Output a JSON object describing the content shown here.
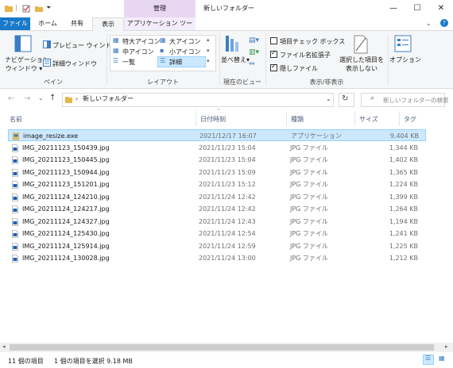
{
  "window": {
    "title": "新しいフォルダー",
    "context_tab_header": "管理",
    "minimize": "—",
    "maximize": "☐",
    "close": "✕"
  },
  "tabs": {
    "file": "ファイル",
    "home": "ホーム",
    "share": "共有",
    "view": "表示",
    "app_tools": "アプリケーション ツール"
  },
  "ribbon": {
    "pane": {
      "nav_pane": "ナビゲーション\nウィンドウ",
      "nav_pane_line1": "ナビゲーション",
      "nav_pane_line2": "ウィンドウ",
      "preview": "プレビュー ウィンドウ",
      "details": "詳細ウィンドウ",
      "label": "ペイン"
    },
    "layout": {
      "xl_icons": "特大アイコン",
      "l_icons": "大アイコン",
      "m_icons": "中アイコン",
      "s_icons": "小アイコン",
      "list": "一覧",
      "details": "詳細",
      "label": "レイアウト"
    },
    "current_view": {
      "sort": "並べ替え",
      "label": "現在のビュー"
    },
    "show_hide": {
      "item_checkboxes": "項目チェック ボックス",
      "file_extensions": "ファイル名拡張子",
      "hidden_items": "隠しファイル",
      "item_checkboxes_on": false,
      "file_extensions_on": true,
      "hidden_items_on": true,
      "hide_selected_line1": "選択した項目を",
      "hide_selected_line2": "表示しない",
      "options": "オプション",
      "label": "表示/非表示"
    }
  },
  "address": {
    "path": "新しいフォルダー",
    "search_placeholder": "新しいフォルダーの検索"
  },
  "columns": {
    "name": "名前",
    "date": "日付時刻",
    "type": "種類",
    "size": "サイズ",
    "tag": "タグ"
  },
  "files": [
    {
      "name": "image_resize.exe",
      "date": "2021/12/17 16:07",
      "type": "アプリケーション",
      "size": "9,404 KB",
      "icon": "exe-icon"
    },
    {
      "name": "IMG_20211123_150439.jpg",
      "date": "2021/11/23 15:04",
      "type": "JPG ファイル",
      "size": "1,344 KB",
      "icon": "jpg-file-icon"
    },
    {
      "name": "IMG_20211123_150445.jpg",
      "date": "2021/11/23 15:04",
      "type": "JPG ファイル",
      "size": "1,402 KB",
      "icon": "jpg-file-icon"
    },
    {
      "name": "IMG_20211123_150944.jpg",
      "date": "2021/11/23 15:09",
      "type": "JPG ファイル",
      "size": "1,365 KB",
      "icon": "jpg-file-icon"
    },
    {
      "name": "IMG_20211123_151201.jpg",
      "date": "2021/11/23 15:12",
      "type": "JPG ファイル",
      "size": "1,224 KB",
      "icon": "jpg-file-icon"
    },
    {
      "name": "IMG_20211124_124210.jpg",
      "date": "2021/11/24 12:42",
      "type": "JPG ファイル",
      "size": "1,399 KB",
      "icon": "jpg-file-icon"
    },
    {
      "name": "IMG_20211124_124217.jpg",
      "date": "2021/11/24 12:42",
      "type": "JPG ファイル",
      "size": "1,264 KB",
      "icon": "jpg-file-icon"
    },
    {
      "name": "IMG_20211124_124327.jpg",
      "date": "2021/11/24 12:43",
      "type": "JPG ファイル",
      "size": "1,194 KB",
      "icon": "jpg-file-icon"
    },
    {
      "name": "IMG_20211124_125430.jpg",
      "date": "2021/11/24 12:54",
      "type": "JPG ファイル",
      "size": "1,241 KB",
      "icon": "jpg-file-icon"
    },
    {
      "name": "IMG_20211124_125914.jpg",
      "date": "2021/11/24 12:59",
      "type": "JPG ファイル",
      "size": "1,225 KB",
      "icon": "jpg-file-icon"
    },
    {
      "name": "IMG_20211124_130028.jpg",
      "date": "2021/11/24 13:00",
      "type": "JPG ファイル",
      "size": "1,212 KB",
      "icon": "jpg-file-icon"
    }
  ],
  "selected_index": 0,
  "status": {
    "count": "11 個の項目",
    "selection": "1 個の項目を選択  9.18 MB"
  },
  "colors": {
    "accent": "#1979ca",
    "selection": "#cce8ff",
    "context_tab": "#e8d7f3"
  }
}
